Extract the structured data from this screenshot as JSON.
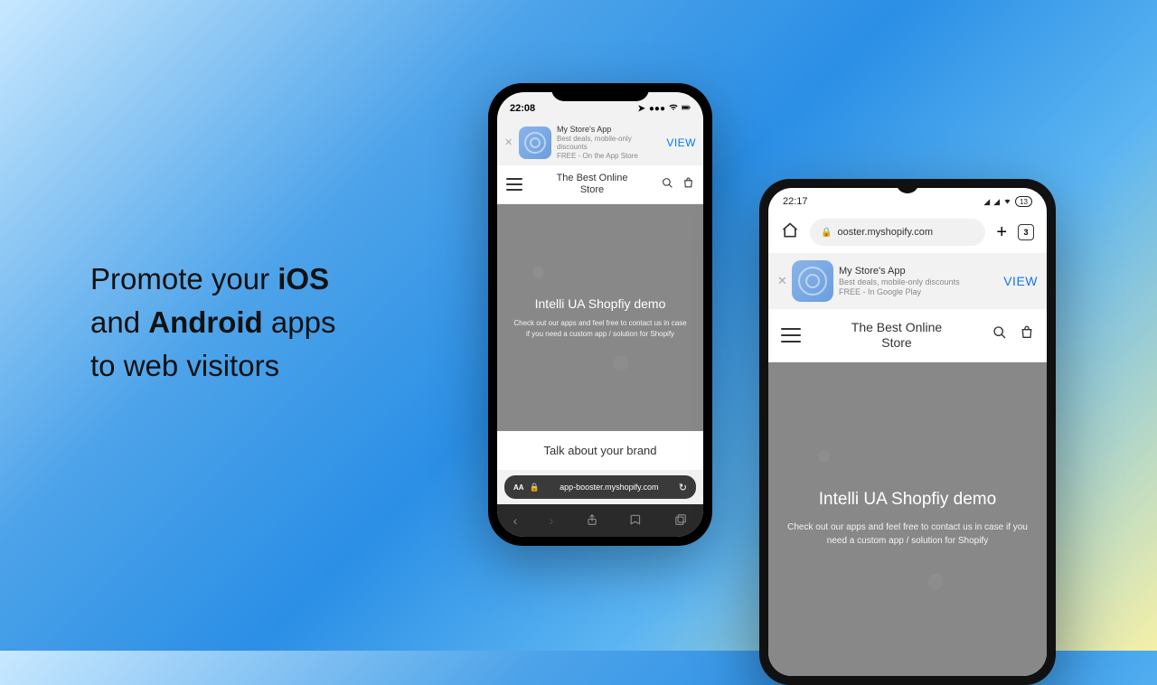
{
  "headline": {
    "line1_a": "Promote your ",
    "line1_b": "iOS",
    "line2_a": "and ",
    "line2_b": "Android",
    "line2_c": " apps",
    "line3": "to web visitors"
  },
  "ios": {
    "time": "22:08",
    "banner": {
      "title": "My Store's App",
      "subtitle": "Best deals, mobile-only discounts",
      "price_line": "FREE - On the App Store",
      "cta": "VIEW"
    },
    "store_title": "The Best Online Store",
    "hero_title": "Intelli UA Shopfiy demo",
    "hero_sub": "Check out our apps and feel free to contact us in case if you need a custom app / solution for Shopify",
    "brand_section": "Talk about your brand",
    "url_aa": "AA",
    "url": "app-booster.myshopify.com"
  },
  "android": {
    "time": "22:17",
    "battery": "13",
    "tab_count": "3",
    "url": "ooster.myshopify.com",
    "banner": {
      "title": "My Store's App",
      "subtitle": "Best deals, mobile-only discounts",
      "price_line": "FREE - In Google Play",
      "cta": "VIEW"
    },
    "store_title": "The Best Online Store",
    "hero_title": "Intelli UA Shopfiy demo",
    "hero_sub": "Check out our apps and feel free to contact us in case if you need a custom app / solution for Shopify"
  }
}
